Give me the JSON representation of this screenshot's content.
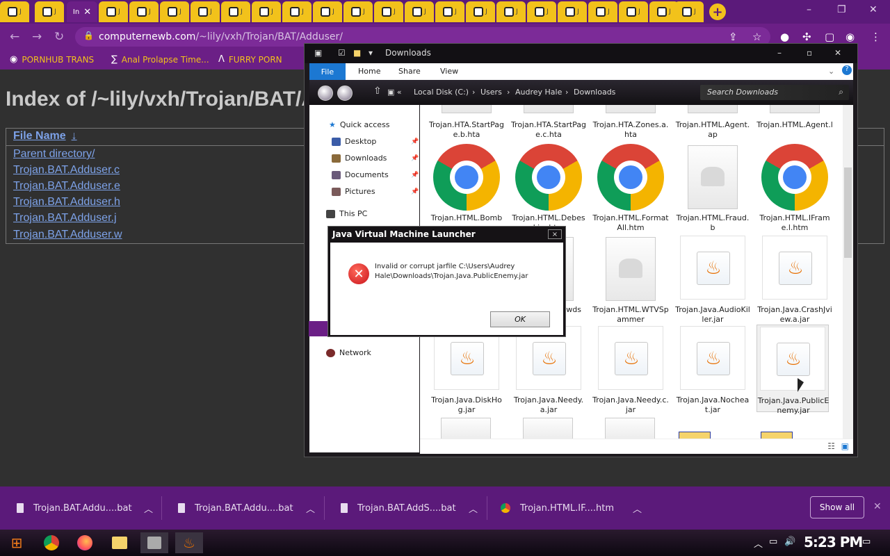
{
  "browser": {
    "active_tab_label": "In",
    "new_tab_label": "+",
    "url_host": "computernewb.com",
    "url_path": "/~lily/vxh/Trojan/BAT/Adduser/"
  },
  "bookmarks": [
    {
      "label": "PORNHUB TRANS"
    },
    {
      "label": "Anal Prolapse Time..."
    },
    {
      "label": "FURRY PORN"
    }
  ],
  "page": {
    "heading": "Index of /~lily/vxh/Trojan/BAT/Adduser/",
    "column_header": "File Name",
    "sort_arrow": "↓",
    "links": [
      "Parent directory/",
      "Trojan.BAT.Adduser.c",
      "Trojan.BAT.Adduser.e",
      "Trojan.BAT.Adduser.h",
      "Trojan.BAT.Adduser.j",
      "Trojan.BAT.Adduser.w"
    ]
  },
  "explorer": {
    "title": "Downloads",
    "ribbon": {
      "file": "File",
      "home": "Home",
      "share": "Share",
      "view": "View"
    },
    "breadcrumb": [
      "Local Disk (C:)",
      "Users",
      "Audrey Hale",
      "Downloads"
    ],
    "search_placeholder": "Search Downloads",
    "nav": {
      "quick_access": "Quick access",
      "desktop": "Desktop",
      "downloads": "Downloads",
      "documents": "Documents",
      "pictures": "Pictures",
      "this_pc": "This PC",
      "network": "Network"
    },
    "files": {
      "r0c0": "Trojan.HTA.StartPage.b.hta",
      "r0c1": "Trojan.HTA.StartPage.c.hta",
      "r0c2": "Trojan.HTA.Zones.a.hta",
      "r0c3": "Trojan.HTML.Agent.ap",
      "r0c4": "Trojan.HTML.Agent.l",
      "r1c0": "Trojan.HTML.Bomb",
      "r1c1": "Trojan.HTML.Debeski.c.htm",
      "r1c2": "Trojan.HTML.FormatAll.htm",
      "r1c3": "Trojan.HTML.Fraud.b",
      "r1c4": "Trojan.HTML.IFrame.l.htm",
      "r2c1": "wds",
      "r2c2": "Trojan.HTML.WTVSpammer",
      "r2c3": "Trojan.Java.AudioKiller.jar",
      "r2c4": "Trojan.Java.CrashJview.a.jar",
      "r3c0": "Trojan.Java.DiskHog.jar",
      "r3c1": "Trojan.Java.Needy.a.jar",
      "r3c2": "Trojan.Java.Needy.c.jar",
      "r3c3": "Trojan.Java.Nocheat.jar",
      "r3c4": "Trojan.Java.PublicEnemy.jar"
    }
  },
  "dialog": {
    "title": "Java Virtual Machine Launcher",
    "close": "×",
    "message": "Invalid or corrupt jarfile C:\\Users\\Audrey Hale\\Downloads\\Trojan.Java.PublicEnemy.jar",
    "ok": "OK"
  },
  "shelf": {
    "downloads": [
      "Trojan.BAT.Addu....bat",
      "Trojan.BAT.Addu....bat",
      "Trojan.BAT.AddS....bat",
      "Trojan.HTML.IF....htm"
    ],
    "show_all": "Show all"
  },
  "taskbar": {
    "clock": "5:23 PM"
  },
  "colors": {
    "chrome_purple": "#6b1f86",
    "tab_yellow": "#f2c21b",
    "link_blue": "#7da2e8"
  }
}
